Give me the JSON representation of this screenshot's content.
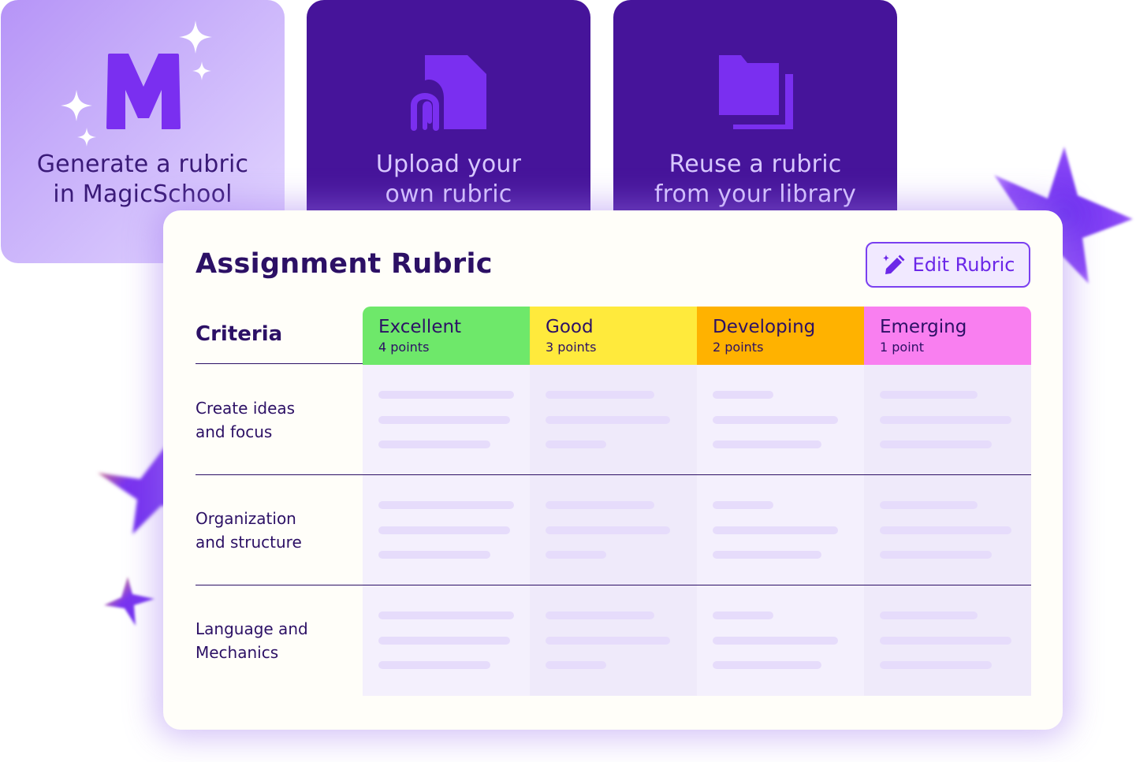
{
  "cards": {
    "generate": {
      "label": "Generate a rubric\nin MagicSchool",
      "icon": "magicschool-m-icon"
    },
    "upload": {
      "label": "Upload your\nown rubric",
      "icon": "document-clip-icon"
    },
    "reuse": {
      "label": "Reuse a rubric\nfrom your library",
      "icon": "folder-stack-icon"
    }
  },
  "rubric": {
    "title": "Assignment Rubric",
    "edit_button": {
      "label": "Edit Rubric",
      "icon": "magic-pencil-icon"
    },
    "criteria_header": "Criteria",
    "levels": [
      {
        "name": "Excellent",
        "points": "4 points",
        "color": "#6ee86a"
      },
      {
        "name": "Good",
        "points": "3 points",
        "color": "#ffea3c"
      },
      {
        "name": "Developing",
        "points": "2 points",
        "color": "#ffb200"
      },
      {
        "name": "Emerging",
        "points": "1 point",
        "color": "#f97ff0"
      }
    ],
    "criteria": [
      {
        "label": "Create ideas\nand focus"
      },
      {
        "label": "Organization\nand structure"
      },
      {
        "label": "Language and\nMechanics"
      }
    ]
  },
  "colors": {
    "primary_purple": "#46149a",
    "accent_violet": "#7a3ff0",
    "text_dark": "#2c1065"
  }
}
